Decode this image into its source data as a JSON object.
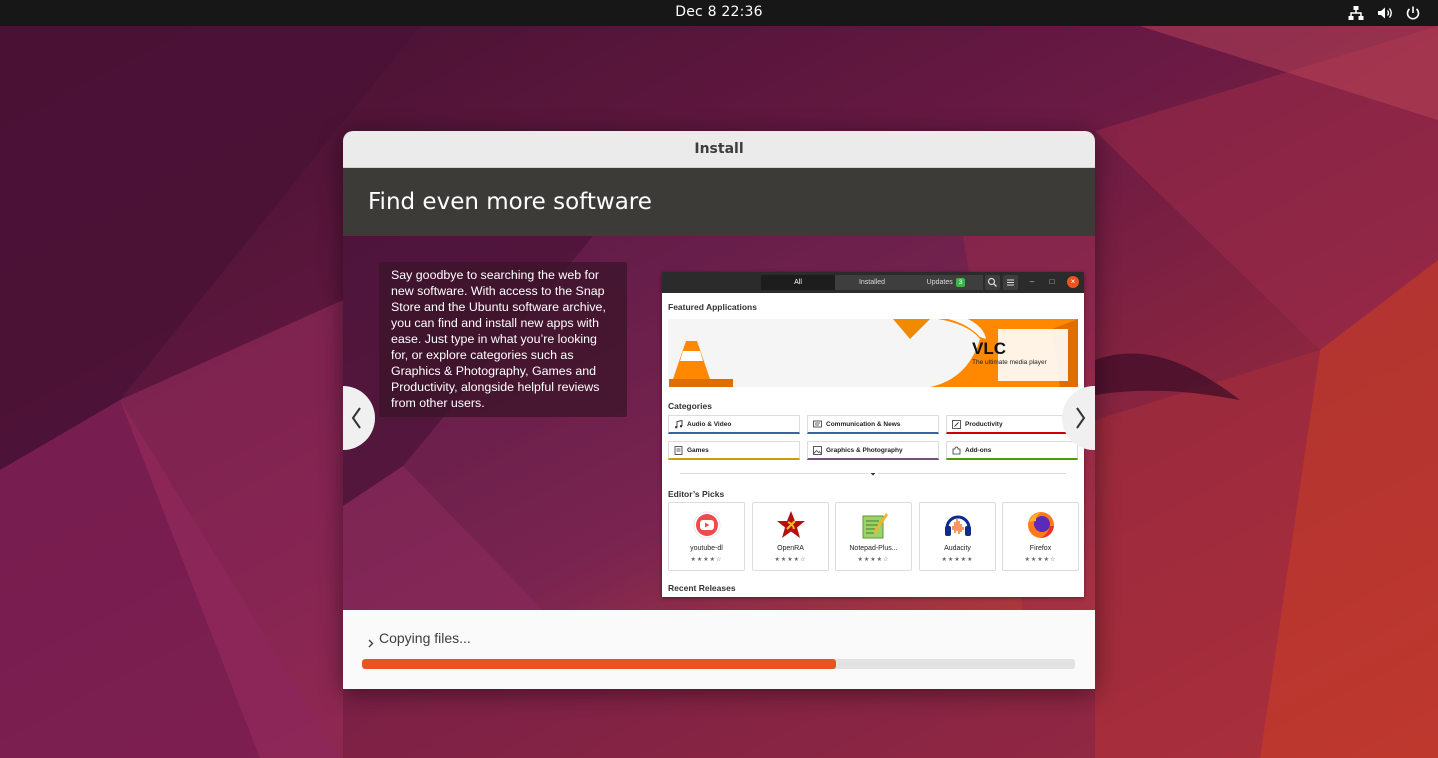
{
  "topbar": {
    "clock": "Dec 8  22:36",
    "icons": [
      "network-icon",
      "volume-icon",
      "power-icon"
    ]
  },
  "installer": {
    "window_title": "Install",
    "slide": {
      "title": "Find even more software",
      "description": "Say goodbye to searching the web for new software. With access to the Snap Store and the Ubuntu software archive, you can find and install new apps with ease. Just type in what you’re looking for, or explore categories such as Graphics & Photography, Games and Productivity, alongside helpful reviews from other users."
    },
    "nav": {
      "prev_icon": "chevron-left-icon",
      "next_icon": "chevron-right-icon"
    },
    "software_center": {
      "tabs": {
        "all": "All",
        "installed": "Installed",
        "updates": "Updates",
        "updates_count": "3"
      },
      "featured_label": "Featured Applications",
      "banner": {
        "title": "VLC",
        "subtitle": "The ultimate media player"
      },
      "categories_label": "Categories",
      "categories": [
        {
          "label": "Audio & Video",
          "icon": "music-note-icon",
          "color": "#3465a4"
        },
        {
          "label": "Communication & News",
          "icon": "chat-icon",
          "color": "#3465a4"
        },
        {
          "label": "Productivity",
          "icon": "pencil-icon",
          "color": "#cc0000"
        },
        {
          "label": "Games",
          "icon": "document-icon",
          "color": "#c4a000"
        },
        {
          "label": "Graphics & Photography",
          "icon": "image-icon",
          "color": "#75507b"
        },
        {
          "label": "Add-ons",
          "icon": "puzzle-icon",
          "color": "#4e9a06"
        }
      ],
      "editors_picks_label": "Editor’s Picks",
      "picks": [
        {
          "name": "youtube-dl",
          "stars": "★★★★☆",
          "rating": 4
        },
        {
          "name": "OpenRA",
          "stars": "★★★★☆",
          "rating": 4
        },
        {
          "name": "Notepad-Plus...",
          "stars": "★★★★☆",
          "rating": 4
        },
        {
          "name": "Audacity",
          "stars": "★★★★★",
          "rating": 5
        },
        {
          "name": "Firefox",
          "stars": "★★★★☆",
          "rating": 4
        }
      ],
      "recent_releases_label": "Recent Releases"
    },
    "progress": {
      "status": "Copying files...",
      "fraction": 0.665,
      "color": "#e95420"
    }
  }
}
